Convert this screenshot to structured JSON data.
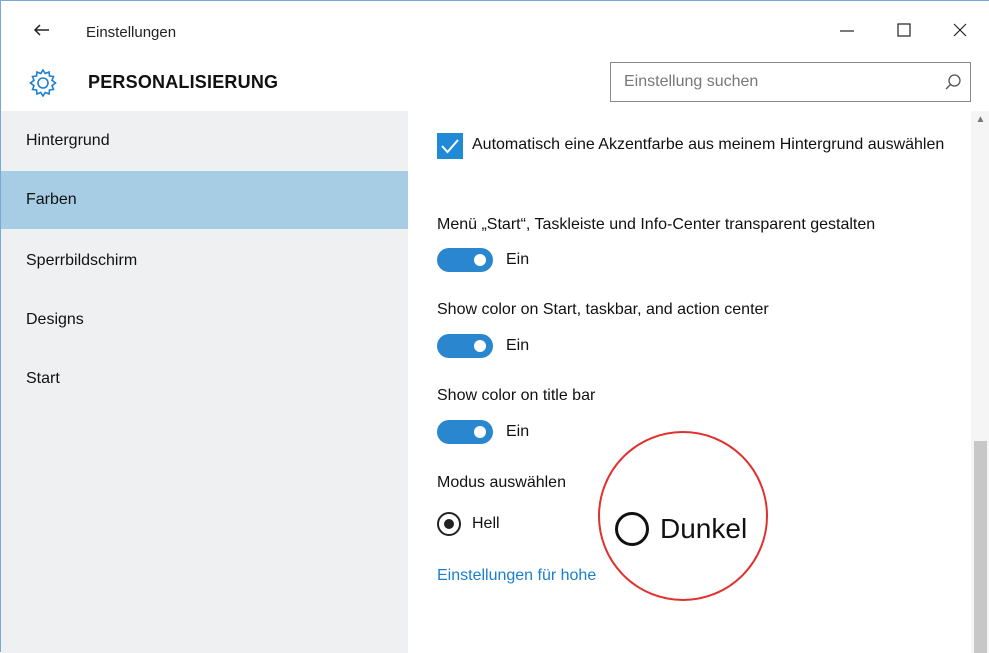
{
  "window": {
    "title": "Einstellungen",
    "back_icon": "arrow-left-icon",
    "minimize": "—",
    "maximize": "☐",
    "close": "✕"
  },
  "header": {
    "icon": "gear-icon",
    "title": "PERSONALISIERUNG",
    "search_placeholder": "Einstellung suchen",
    "search_icon": "search-icon"
  },
  "sidebar": {
    "items": [
      {
        "label": "Hintergrund",
        "selected": false
      },
      {
        "label": "Farben",
        "selected": true
      },
      {
        "label": "Sperrbildschirm",
        "selected": false
      },
      {
        "label": "Designs",
        "selected": false
      },
      {
        "label": "Start",
        "selected": false
      }
    ]
  },
  "content": {
    "auto_accent": {
      "label": "Automatisch eine Akzentfarbe aus meinem Hintergrund auswählen",
      "checked": true
    },
    "transparent": {
      "label": "Menü „Start“, Taskleiste und Info-Center transparent gestalten",
      "state": "Ein"
    },
    "show_color_start": {
      "label": "Show color on Start, taskbar, and action center",
      "state": "Ein"
    },
    "show_color_title": {
      "label": "Show color on title bar",
      "state": "Ein"
    },
    "mode": {
      "label": "Modus auswählen",
      "options": [
        "Hell",
        "Dunkel"
      ],
      "selected": "Hell"
    },
    "link": "Einstellungen für hohe"
  },
  "colors": {
    "accent": "#2a87cf",
    "sidebar_selected": "#a7cde4",
    "highlight_circle": "#e0312f",
    "link": "#1a7fcf"
  }
}
